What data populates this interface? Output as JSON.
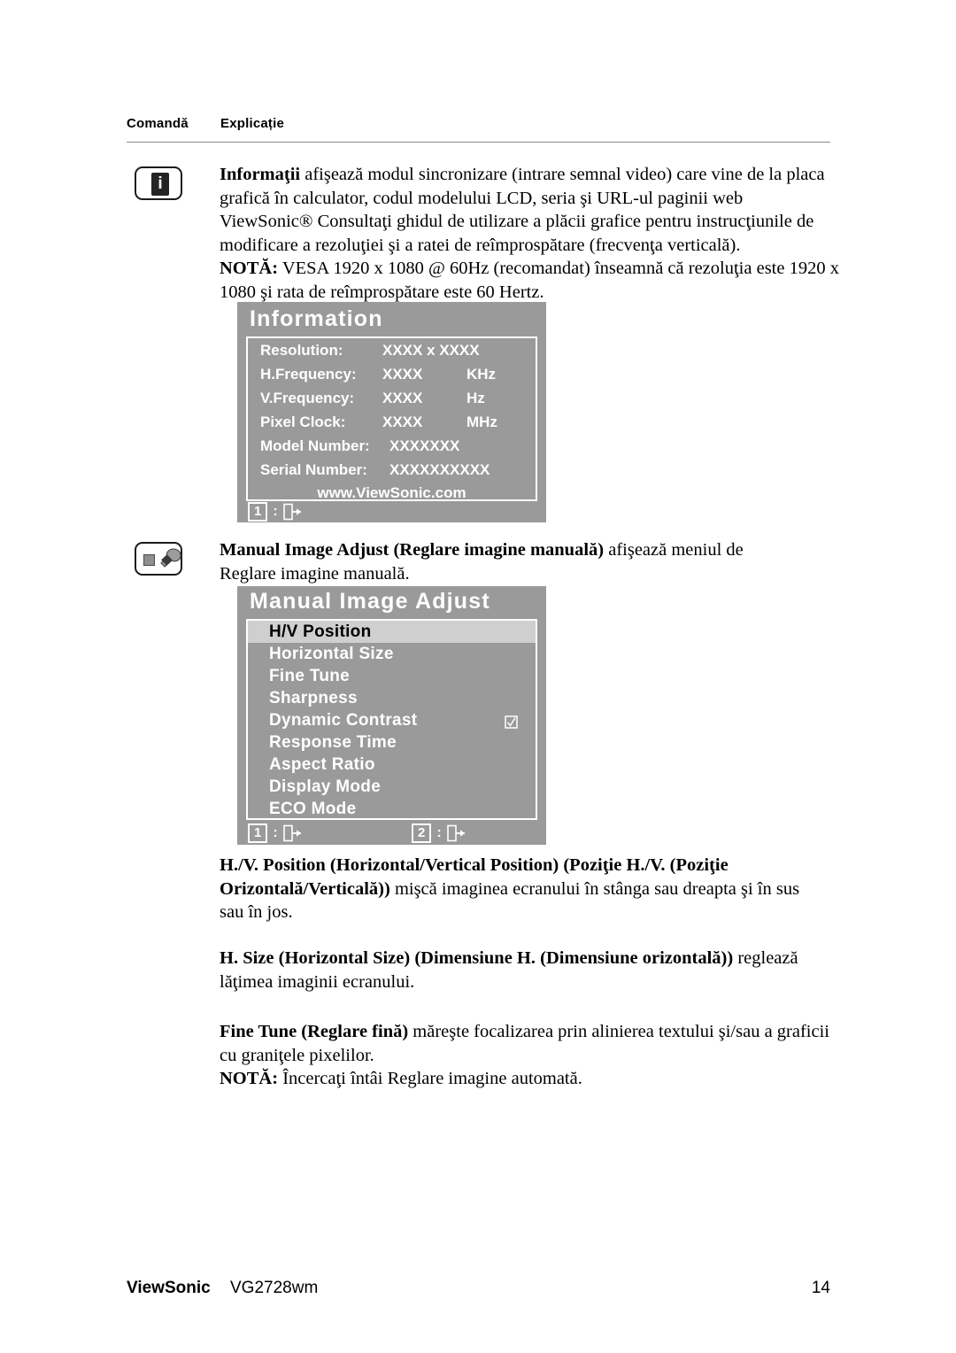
{
  "table_header": {
    "col1": "Comandă",
    "col2": "Explicație"
  },
  "sections": {
    "information": {
      "icon_name": "information-icon",
      "paragraph_html": "<b>Informaţii</b> afişează modul sincronizare (intrare semnal video) care vine de la placa grafică în calculator, codul modelului LCD, seria şi URL-ul paginii web ViewSonic® Consultaţi ghidul de utilizare a plăcii grafice pentru instrucţiunile de modificare a rezoluţiei şi a ratei de reîmprospătare (frecvenţa verticală).<br><b>NOTĂ:</b> VESA 1920 x 1080 @ 60Hz (recomandat) înseamnă că rezoluţia este 1920 x 1080 şi rata de reîmprospătare este 60 Hertz."
    },
    "manual_image_adjust": {
      "icon_name": "manual-image-adjust-icon",
      "paragraph_html": "<b>Manual Image Adjust (Reglare imagine manuală)</b> afişează meniul de Reglare imagine manuală."
    },
    "hv_position": {
      "paragraph_html": "<b>H./V. Position (Horizontal/Vertical Position) (Poziţie H./V. (Poziţie Orizontală/Verticală))</b> mişcă imaginea ecranului în stânga sau dreapta şi în sus sau în jos."
    },
    "h_size": {
      "paragraph_html": "<b>H. Size (Horizontal Size) (Dimensiune H. (Dimensiune orizontală))</b> reglează lăţimea imaginii ecranului."
    },
    "fine_tune": {
      "paragraph_html": "<b>Fine Tune (Reglare fină)</b> măreşte focalizarea prin alinierea textului şi/sau a graficii cu graniţele pixelilor.<br><b>NOTĂ:</b> Încercaţi întâi Reglare imagine automată."
    }
  },
  "osd_information": {
    "title": "Information",
    "rows": [
      {
        "label": "Resolution:",
        "value": "XXXX x XXXX",
        "unit": ""
      },
      {
        "label": "H.Frequency:",
        "value": "XXXX",
        "unit": "KHz"
      },
      {
        "label": "V.Frequency:",
        "value": "XXXX",
        "unit": "Hz"
      },
      {
        "label": "Pixel Clock:",
        "value": "XXXX",
        "unit": "MHz"
      },
      {
        "label": "Model Number:",
        "value": "XXXXXXX",
        "unit": ""
      },
      {
        "label": "Serial Number:",
        "value": "XXXXXXXXXX",
        "unit": ""
      }
    ],
    "url": "www.ViewSonic.com",
    "footer": {
      "key1": "1",
      "colon": ":",
      "icon1_name": "exit-door-icon"
    },
    "colors": {
      "panel_bg": "#9a9a9a",
      "text": "#ffffff"
    }
  },
  "osd_manual_image_adjust": {
    "title": "Manual Image Adjust",
    "items": [
      {
        "label": "H/V Position",
        "selected": true,
        "checkbox": false
      },
      {
        "label": "Horizontal Size",
        "selected": false,
        "checkbox": false
      },
      {
        "label": "Fine Tune",
        "selected": false,
        "checkbox": false
      },
      {
        "label": "Sharpness",
        "selected": false,
        "checkbox": false
      },
      {
        "label": "Dynamic Contrast",
        "selected": false,
        "checkbox": true
      },
      {
        "label": "Response Time",
        "selected": false,
        "checkbox": false
      },
      {
        "label": "Aspect Ratio",
        "selected": false,
        "checkbox": false
      },
      {
        "label": "Display Mode",
        "selected": false,
        "checkbox": false
      },
      {
        "label": "ECO Mode",
        "selected": false,
        "checkbox": false
      }
    ],
    "footer": {
      "key1": "1",
      "key2": "2",
      "colon": ":",
      "icon1_name": "exit-door-icon",
      "icon2_name": "enter-door-icon"
    },
    "colors": {
      "panel_bg": "#9a9a9a",
      "selected_bg": "#cfcfcf",
      "selected_text": "#000000",
      "text": "#ffffff"
    }
  },
  "page_footer": {
    "brand": "ViewSonic",
    "model": "VG2728wm",
    "page_number": "14"
  }
}
